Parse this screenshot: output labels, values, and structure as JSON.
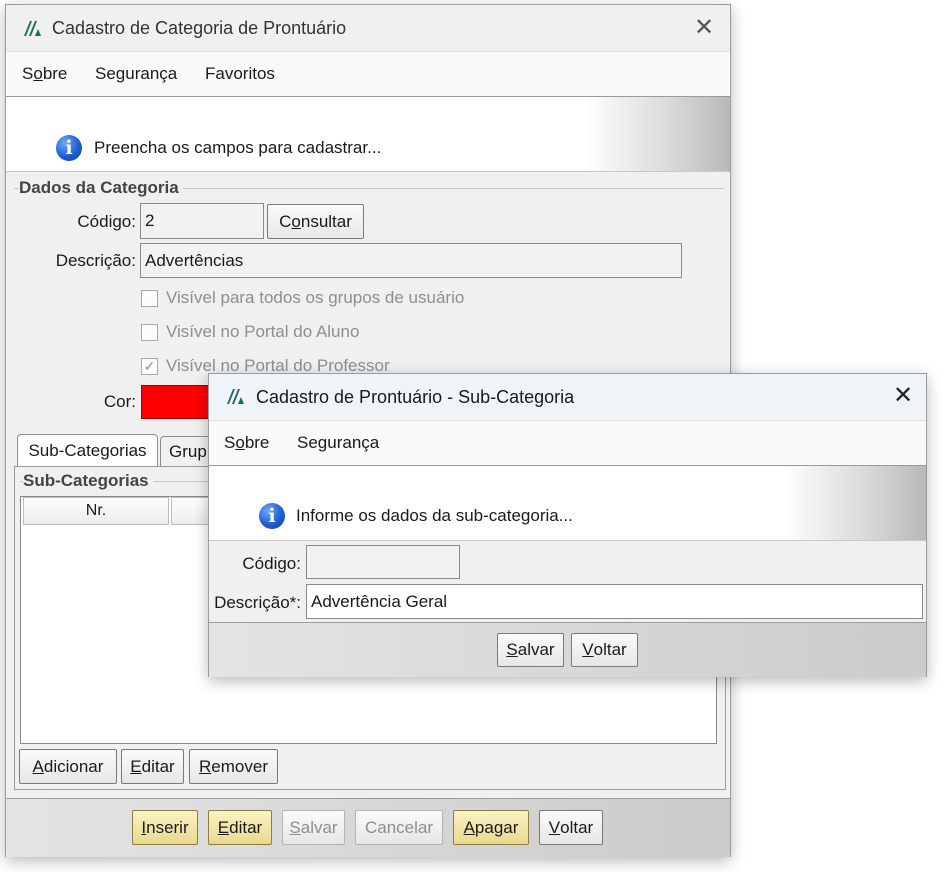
{
  "main_window": {
    "title": "Cadastro de Categoria de Prontuário",
    "close_glyph": "✕",
    "menu": [
      {
        "prefix": "S",
        "mnemonic": "o",
        "rest": "bre"
      },
      {
        "prefix": "",
        "mnemonic": "",
        "rest": "Segurança"
      },
      {
        "prefix": "",
        "mnemonic": "",
        "rest": "Favoritos"
      }
    ],
    "info_icon": "i",
    "info_text": "Preencha os campos para cadastrar...",
    "group_title": "Dados da Categoria",
    "codigo_label": "Código:",
    "codigo_value": "2",
    "consultar_button": {
      "prefix": "C",
      "mnemonic": "o",
      "rest": "nsultar"
    },
    "descricao_label": "Descrição:",
    "descricao_value": "Advertências",
    "checkboxes": [
      {
        "label": "Visível para todos os grupos de usuário",
        "checked": false,
        "mark": ""
      },
      {
        "label": "Visível no Portal do Aluno",
        "checked": false,
        "mark": ""
      },
      {
        "label": "Visível no Portal do Professor",
        "checked": true,
        "mark": "✓"
      }
    ],
    "cor_label": "Cor:",
    "cor_color": "#ff0000",
    "tabs": [
      "Sub-Categorias",
      "Grup"
    ],
    "subcategorias_group_title": "Sub-Categorias",
    "table_headers": [
      "Nr.",
      ""
    ],
    "list_buttons": [
      {
        "mnemonic": "A",
        "rest": "dicionar"
      },
      {
        "mnemonic": "E",
        "rest": "ditar"
      },
      {
        "mnemonic": "R",
        "rest": "emover"
      }
    ],
    "footer_buttons": [
      {
        "mnemonic": "I",
        "rest": "nserir",
        "style": "yellow"
      },
      {
        "mnemonic": "E",
        "rest": "ditar",
        "style": "yellow"
      },
      {
        "mnemonic": "S",
        "rest": "alvar",
        "style": "disabled"
      },
      {
        "mnemonic": "",
        "rest": "Cancelar",
        "style": "disabled"
      },
      {
        "mnemonic": "A",
        "rest": "pagar",
        "style": "yellow"
      },
      {
        "mnemonic": "V",
        "rest": "oltar",
        "style": "normal"
      }
    ]
  },
  "sub_window": {
    "title": "Cadastro de Prontuário - Sub-Categoria",
    "close_glyph": "✕",
    "menu": [
      {
        "prefix": "S",
        "mnemonic": "o",
        "rest": "bre"
      },
      {
        "prefix": "",
        "mnemonic": "",
        "rest": "Segurança"
      }
    ],
    "info_icon": "i",
    "info_text": "Informe os dados da sub-categoria...",
    "codigo_label": "Código:",
    "codigo_value": "",
    "descricao_label": "Descrição*:",
    "descricao_value": "Advertência Geral",
    "salvar_button": {
      "mnemonic": "S",
      "rest": "alvar"
    },
    "voltar_button": {
      "mnemonic": "V",
      "rest": "oltar"
    }
  },
  "colors": {
    "info_icon": "#1f5fd1",
    "button_primary": "#e9d88c",
    "color_swatch": "#ff0000"
  }
}
